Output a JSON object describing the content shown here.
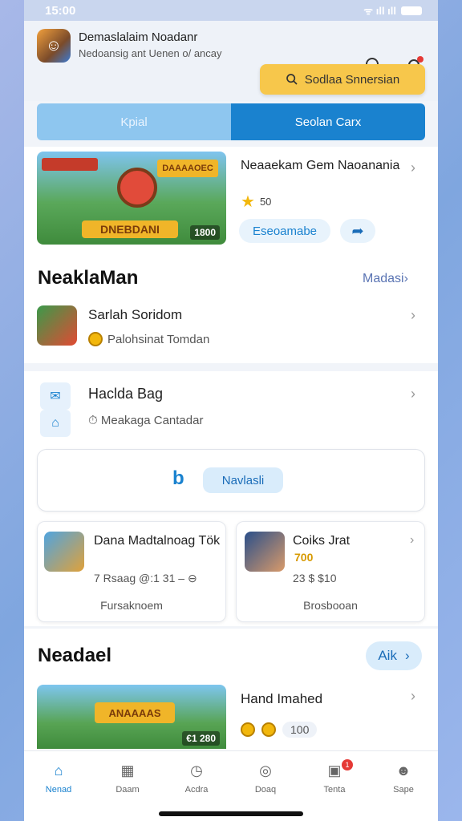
{
  "status": {
    "time": "15:00",
    "signal": "ᯤ ıll ıll"
  },
  "header": {
    "title": "Demaslalaim Noadanr",
    "subtitle": "Nedoansig ant Uenen o/ ancay",
    "promo_button": "Sodlaa Snnersian"
  },
  "segments": {
    "left": "Kpial",
    "right": "Seolan Carx"
  },
  "featured": {
    "title": "Neaaekam Gem Naoanania",
    "rating": "50",
    "image_logo": "DNEBDANI",
    "image_top_logo": "DAAAAOEC",
    "image_tag": "1800",
    "action_button": "Eseoamabe"
  },
  "section1": {
    "title": "NeaklaMan",
    "link": "Madasi",
    "row": {
      "title": "Sarlah Soridom",
      "subtitle": "Palohsinat Tomdan"
    }
  },
  "bag": {
    "title": "Haclda Bag",
    "subtitle": "Meakaga Cantadar",
    "nav_button": "Navlasli"
  },
  "cards": [
    {
      "title": "Dana Madtalnoag Tök",
      "meta": "7 Rsaag @:1 31 –",
      "footer": "Fursaknoem"
    },
    {
      "title": "Coiks Jrat",
      "price": "700",
      "meta": "23 $ $10",
      "footer": "Brosbooan"
    }
  ],
  "section2": {
    "title": "Neadael",
    "pill": "Aik",
    "item": {
      "name": "Hand Imahed",
      "image_logo": "ANAAAAS",
      "image_tag": "€1 280",
      "value": "100"
    }
  },
  "tabs": [
    {
      "label": "Nenad",
      "icon": "home-icon",
      "active": true
    },
    {
      "label": "Daam",
      "icon": "calendar-icon"
    },
    {
      "label": "Acdra",
      "icon": "clock-icon"
    },
    {
      "label": "Doaq",
      "icon": "camera-icon"
    },
    {
      "label": "Tenta",
      "icon": "inbox-icon",
      "badge": "1"
    },
    {
      "label": "Sape",
      "icon": "profile-icon"
    }
  ],
  "colors": {
    "accent": "#1a82cf",
    "promo": "#f7c74b",
    "badge": "#e53935"
  }
}
